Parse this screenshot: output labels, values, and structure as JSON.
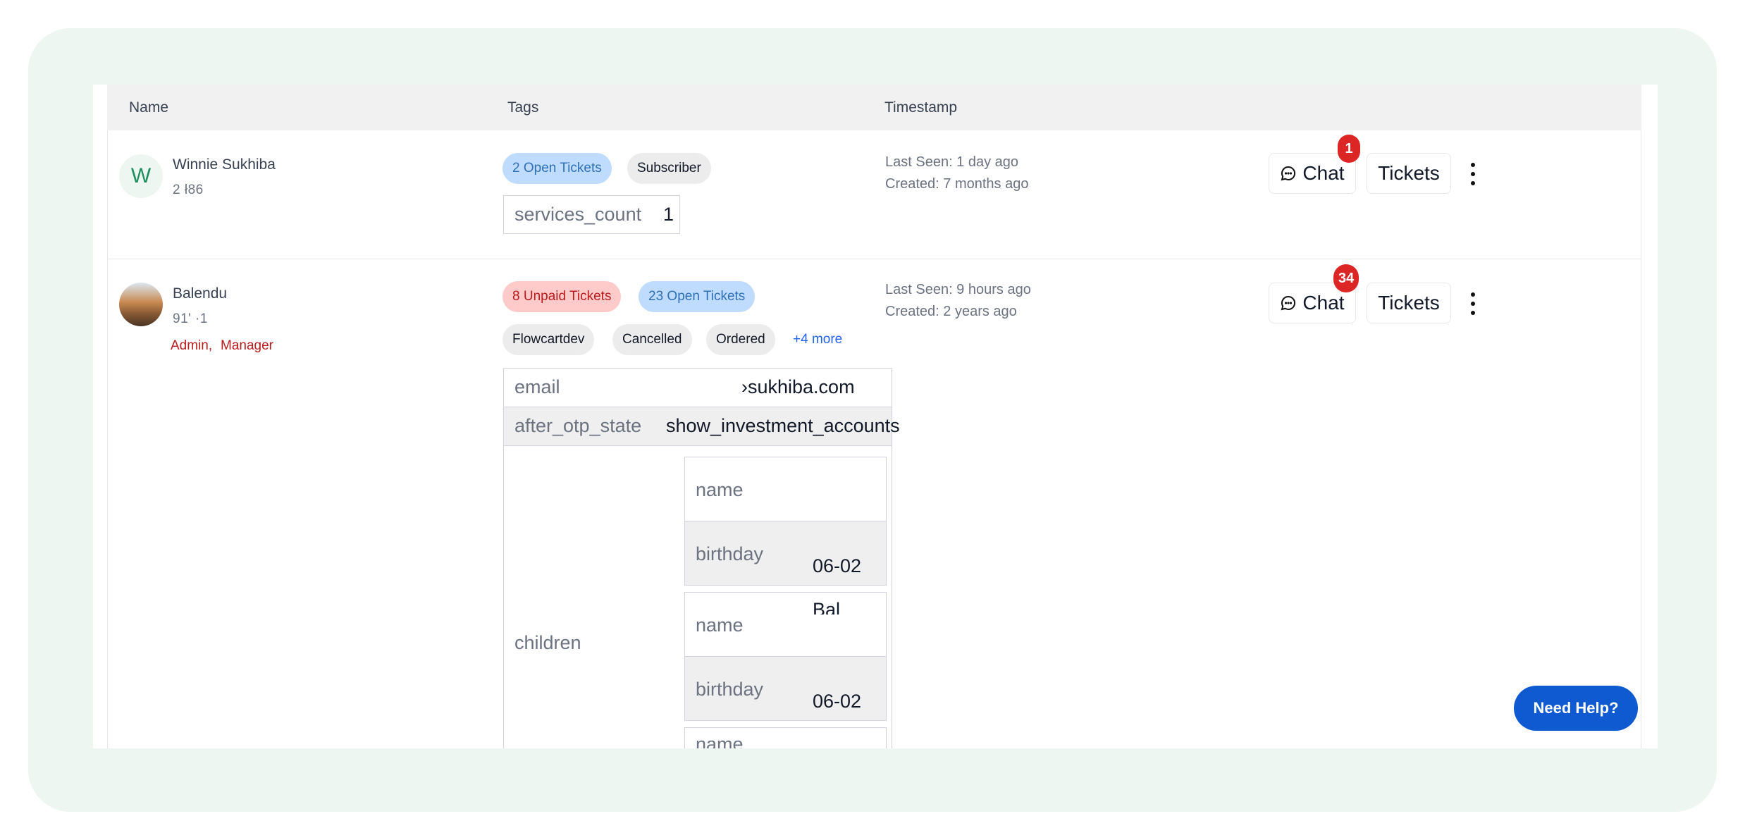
{
  "table": {
    "headers": {
      "name": "Name",
      "tags": "Tags",
      "timestamp": "Timestamp"
    }
  },
  "rows": [
    {
      "avatar_letter": "W",
      "name": "Winnie Sukhiba",
      "phone": "2            ł86",
      "tags": [
        "2 Open Tickets",
        "Subscriber"
      ],
      "attribute": {
        "key": "services_count",
        "value": "1"
      },
      "last_seen": "Last Seen: 1 day ago",
      "created": "Created: 7 months ago",
      "chat_label": "Chat",
      "chat_badge": "1",
      "tickets_label": "Tickets"
    },
    {
      "name": "Balendu",
      "phone": "91'            ·1",
      "roles": [
        "Admin,",
        "Manager"
      ],
      "tags": [
        "8 Unpaid Tickets",
        "23 Open Tickets",
        "Flowcartdev",
        "Cancelled",
        "Ordered"
      ],
      "more_tags": "+4 more",
      "attributes": {
        "email_key": "email",
        "email_value": "›sukhiba.com",
        "otp_key": "after_otp_state",
        "otp_value": "show_investment_accounts",
        "children_key": "children",
        "child1_name_key": "name",
        "child1_birthday_key": "birthday",
        "child1_birthday_value": "06-02",
        "child2_name_key": "name",
        "child2_name_value": "Bal",
        "child2_birthday_key": "birthday",
        "child2_birthday_value": "06-02",
        "child3_name_key": "name"
      },
      "last_seen": "Last Seen: 9 hours ago",
      "created": "Created: 2 years ago",
      "chat_label": "Chat",
      "chat_badge": "34",
      "tickets_label": "Tickets"
    }
  ],
  "help_button": "Need Help?",
  "colors": {
    "accent": "#0f5ad1",
    "badge": "#dc2626",
    "frame": "#eef6f1"
  }
}
